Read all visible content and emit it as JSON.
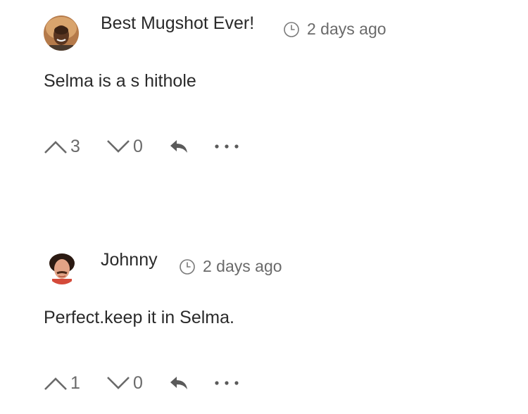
{
  "comments": [
    {
      "author": "Best Mugshot Ever!",
      "time": "2 days ago",
      "text": "Selma is a s hithole",
      "upvotes": "3",
      "downvotes": "0",
      "avatar_icon": "user-avatar-photo"
    },
    {
      "author": "Johnny",
      "time": "2 days ago",
      "text": "Perfect.keep it in Selma.",
      "upvotes": "1",
      "downvotes": "0",
      "avatar_icon": "user-avatar-photo"
    }
  ],
  "icons": {
    "time": "clock-icon",
    "upvote": "chevron-up-icon",
    "downvote": "chevron-down-icon",
    "reply": "reply-icon",
    "more": "more-horizontal-icon"
  },
  "colors": {
    "text_primary": "#2a2a2a",
    "text_secondary": "#6a6a6a",
    "background": "#ffffff"
  }
}
